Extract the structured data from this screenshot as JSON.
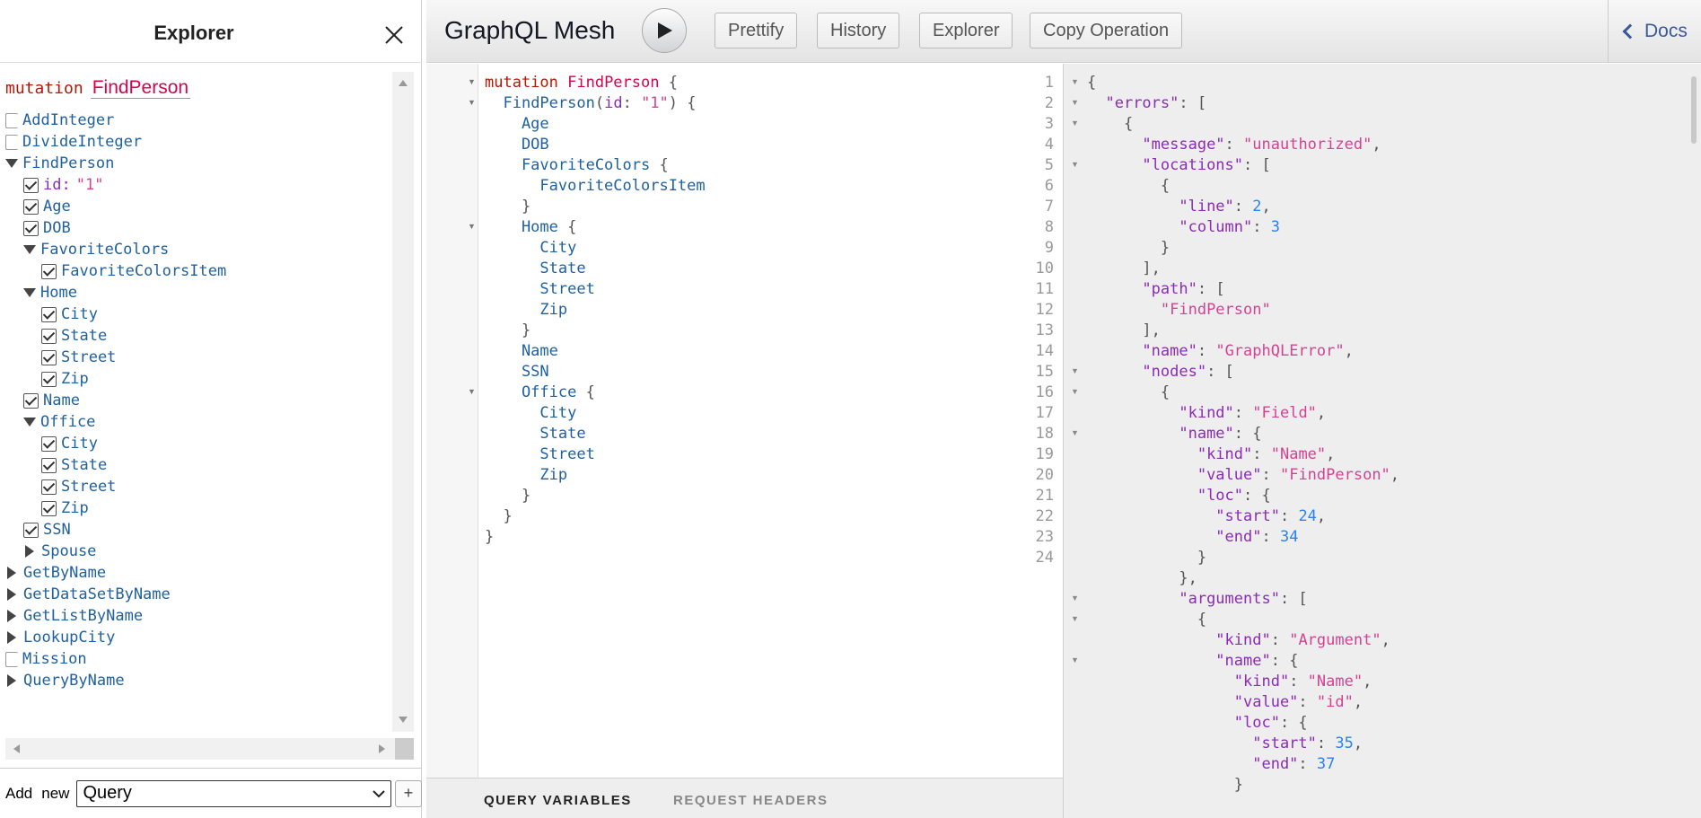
{
  "explorer": {
    "title": "Explorer",
    "operation_keyword": "mutation",
    "operation_name": "FindPerson",
    "tree": [
      {
        "type": "empty",
        "name": "AddInteger",
        "indent": 0
      },
      {
        "type": "empty",
        "name": "DivideInteger",
        "indent": 0
      },
      {
        "type": "open",
        "name": "FindPerson",
        "indent": 0
      },
      {
        "type": "arg",
        "name": "id:",
        "value": "\"1\"",
        "indent": 1
      },
      {
        "type": "checked",
        "name": "Age",
        "indent": 1
      },
      {
        "type": "checked",
        "name": "DOB",
        "indent": 1
      },
      {
        "type": "open",
        "name": "FavoriteColors",
        "indent": 1
      },
      {
        "type": "checked",
        "name": "FavoriteColorsItem",
        "indent": 2
      },
      {
        "type": "open",
        "name": "Home",
        "indent": 1
      },
      {
        "type": "checked",
        "name": "City",
        "indent": 2
      },
      {
        "type": "checked",
        "name": "State",
        "indent": 2
      },
      {
        "type": "checked",
        "name": "Street",
        "indent": 2
      },
      {
        "type": "checked",
        "name": "Zip",
        "indent": 2
      },
      {
        "type": "checked",
        "name": "Name",
        "indent": 1
      },
      {
        "type": "open",
        "name": "Office",
        "indent": 1
      },
      {
        "type": "checked",
        "name": "City",
        "indent": 2
      },
      {
        "type": "checked",
        "name": "State",
        "indent": 2
      },
      {
        "type": "checked",
        "name": "Street",
        "indent": 2
      },
      {
        "type": "checked",
        "name": "Zip",
        "indent": 2
      },
      {
        "type": "checked",
        "name": "SSN",
        "indent": 1
      },
      {
        "type": "closed",
        "name": "Spouse",
        "indent": 1
      },
      {
        "type": "closed",
        "name": "GetByName",
        "indent": 0
      },
      {
        "type": "closed",
        "name": "GetDataSetByName",
        "indent": 0
      },
      {
        "type": "closed",
        "name": "GetListByName",
        "indent": 0
      },
      {
        "type": "closed",
        "name": "LookupCity",
        "indent": 0
      },
      {
        "type": "empty",
        "name": "Mission",
        "indent": 0
      },
      {
        "type": "closed",
        "name": "QueryByName",
        "indent": 0
      }
    ],
    "footer": {
      "add_label": "Add",
      "new_label": "new",
      "select_value": "Query",
      "plus_label": "+"
    }
  },
  "toolbar": {
    "app_title": "GraphQL Mesh",
    "buttons": [
      "Prettify",
      "History",
      "Explorer",
      "Copy Operation"
    ],
    "docs_label": "Docs"
  },
  "editor": {
    "lines": [
      [
        [
          "kw",
          "mutation "
        ],
        [
          "def",
          "FindPerson"
        ],
        [
          "punc",
          " {"
        ]
      ],
      [
        [
          "punc",
          "  "
        ],
        [
          "prop",
          "FindPerson"
        ],
        [
          "punc",
          "("
        ],
        [
          "attr",
          "id"
        ],
        [
          "punc",
          ": "
        ],
        [
          "str",
          "\"1\""
        ],
        [
          "punc",
          ") {"
        ]
      ],
      [
        [
          "prop",
          "    Age"
        ]
      ],
      [
        [
          "prop",
          "    DOB"
        ]
      ],
      [
        [
          "prop",
          "    FavoriteColors"
        ],
        [
          "punc",
          " {"
        ]
      ],
      [
        [
          "prop",
          "      FavoriteColorsItem"
        ]
      ],
      [
        [
          "punc",
          "    }"
        ]
      ],
      [
        [
          "prop",
          "    Home"
        ],
        [
          "punc",
          " {"
        ]
      ],
      [
        [
          "prop",
          "      City"
        ]
      ],
      [
        [
          "prop",
          "      State"
        ]
      ],
      [
        [
          "prop",
          "      Street"
        ]
      ],
      [
        [
          "prop",
          "      Zip"
        ]
      ],
      [
        [
          "punc",
          "    }"
        ]
      ],
      [
        [
          "prop",
          "    Name"
        ]
      ],
      [
        [
          "prop",
          "    SSN"
        ]
      ],
      [
        [
          "prop",
          "    Office"
        ],
        [
          "punc",
          " {"
        ]
      ],
      [
        [
          "prop",
          "      City"
        ]
      ],
      [
        [
          "prop",
          "      State"
        ]
      ],
      [
        [
          "prop",
          "      Street"
        ]
      ],
      [
        [
          "prop",
          "      Zip"
        ]
      ],
      [
        [
          "punc",
          "    }"
        ]
      ],
      [
        [
          "punc",
          "  }"
        ]
      ],
      [
        [
          "punc",
          "}"
        ]
      ],
      []
    ],
    "fold_lines": [
      1,
      2,
      8,
      16
    ]
  },
  "vars_tabs": [
    "QUERY VARIABLES",
    "REQUEST HEADERS"
  ],
  "result": {
    "lines": [
      [
        [
          "punc",
          "{"
        ]
      ],
      [
        [
          "punc",
          "  "
        ],
        [
          "attr",
          "\"errors\""
        ],
        [
          "punc",
          ": ["
        ]
      ],
      [
        [
          "punc",
          "    {"
        ]
      ],
      [
        [
          "punc",
          "      "
        ],
        [
          "attr",
          "\"message\""
        ],
        [
          "punc",
          ": "
        ],
        [
          "str",
          "\"unauthorized\""
        ],
        [
          "punc",
          ","
        ]
      ],
      [
        [
          "punc",
          "      "
        ],
        [
          "attr",
          "\"locations\""
        ],
        [
          "punc",
          ": ["
        ]
      ],
      [
        [
          "punc",
          "        {"
        ]
      ],
      [
        [
          "punc",
          "          "
        ],
        [
          "attr",
          "\"line\""
        ],
        [
          "punc",
          ": "
        ],
        [
          "num",
          "2"
        ],
        [
          "punc",
          ","
        ]
      ],
      [
        [
          "punc",
          "          "
        ],
        [
          "attr",
          "\"column\""
        ],
        [
          "punc",
          ": "
        ],
        [
          "num",
          "3"
        ]
      ],
      [
        [
          "punc",
          "        }"
        ]
      ],
      [
        [
          "punc",
          "      ],"
        ]
      ],
      [
        [
          "punc",
          "      "
        ],
        [
          "attr",
          "\"path\""
        ],
        [
          "punc",
          ": ["
        ]
      ],
      [
        [
          "punc",
          "        "
        ],
        [
          "str",
          "\"FindPerson\""
        ]
      ],
      [
        [
          "punc",
          "      ],"
        ]
      ],
      [
        [
          "punc",
          "      "
        ],
        [
          "attr",
          "\"name\""
        ],
        [
          "punc",
          ": "
        ],
        [
          "str",
          "\"GraphQLError\""
        ],
        [
          "punc",
          ","
        ]
      ],
      [
        [
          "punc",
          "      "
        ],
        [
          "attr",
          "\"nodes\""
        ],
        [
          "punc",
          ": ["
        ]
      ],
      [
        [
          "punc",
          "        {"
        ]
      ],
      [
        [
          "punc",
          "          "
        ],
        [
          "attr",
          "\"kind\""
        ],
        [
          "punc",
          ": "
        ],
        [
          "str",
          "\"Field\""
        ],
        [
          "punc",
          ","
        ]
      ],
      [
        [
          "punc",
          "          "
        ],
        [
          "attr",
          "\"name\""
        ],
        [
          "punc",
          ": {"
        ]
      ],
      [
        [
          "punc",
          "            "
        ],
        [
          "attr",
          "\"kind\""
        ],
        [
          "punc",
          ": "
        ],
        [
          "str",
          "\"Name\""
        ],
        [
          "punc",
          ","
        ]
      ],
      [
        [
          "punc",
          "            "
        ],
        [
          "attr",
          "\"value\""
        ],
        [
          "punc",
          ": "
        ],
        [
          "str",
          "\"FindPerson\""
        ],
        [
          "punc",
          ","
        ]
      ],
      [
        [
          "punc",
          "            "
        ],
        [
          "attr",
          "\"loc\""
        ],
        [
          "punc",
          ": {"
        ]
      ],
      [
        [
          "punc",
          "              "
        ],
        [
          "attr",
          "\"start\""
        ],
        [
          "punc",
          ": "
        ],
        [
          "num",
          "24"
        ],
        [
          "punc",
          ","
        ]
      ],
      [
        [
          "punc",
          "              "
        ],
        [
          "attr",
          "\"end\""
        ],
        [
          "punc",
          ": "
        ],
        [
          "num",
          "34"
        ]
      ],
      [
        [
          "punc",
          "            }"
        ]
      ],
      [
        [
          "punc",
          "          },"
        ]
      ],
      [
        [
          "punc",
          "          "
        ],
        [
          "attr",
          "\"arguments\""
        ],
        [
          "punc",
          ": ["
        ]
      ],
      [
        [
          "punc",
          "            {"
        ]
      ],
      [
        [
          "punc",
          "              "
        ],
        [
          "attr",
          "\"kind\""
        ],
        [
          "punc",
          ": "
        ],
        [
          "str",
          "\"Argument\""
        ],
        [
          "punc",
          ","
        ]
      ],
      [
        [
          "punc",
          "              "
        ],
        [
          "attr",
          "\"name\""
        ],
        [
          "punc",
          ": {"
        ]
      ],
      [
        [
          "punc",
          "                "
        ],
        [
          "attr",
          "\"kind\""
        ],
        [
          "punc",
          ": "
        ],
        [
          "str",
          "\"Name\""
        ],
        [
          "punc",
          ","
        ]
      ],
      [
        [
          "punc",
          "                "
        ],
        [
          "attr",
          "\"value\""
        ],
        [
          "punc",
          ": "
        ],
        [
          "str",
          "\"id\""
        ],
        [
          "punc",
          ","
        ]
      ],
      [
        [
          "punc",
          "                "
        ],
        [
          "attr",
          "\"loc\""
        ],
        [
          "punc",
          ": {"
        ]
      ],
      [
        [
          "punc",
          "                  "
        ],
        [
          "attr",
          "\"start\""
        ],
        [
          "punc",
          ": "
        ],
        [
          "num",
          "35"
        ],
        [
          "punc",
          ","
        ]
      ],
      [
        [
          "punc",
          "                  "
        ],
        [
          "attr",
          "\"end\""
        ],
        [
          "punc",
          ": "
        ],
        [
          "num",
          "37"
        ]
      ],
      [
        [
          "punc",
          "                }"
        ]
      ]
    ],
    "fold_lines": [
      1,
      2,
      3,
      5,
      15,
      16,
      18,
      26,
      27,
      29
    ]
  }
}
